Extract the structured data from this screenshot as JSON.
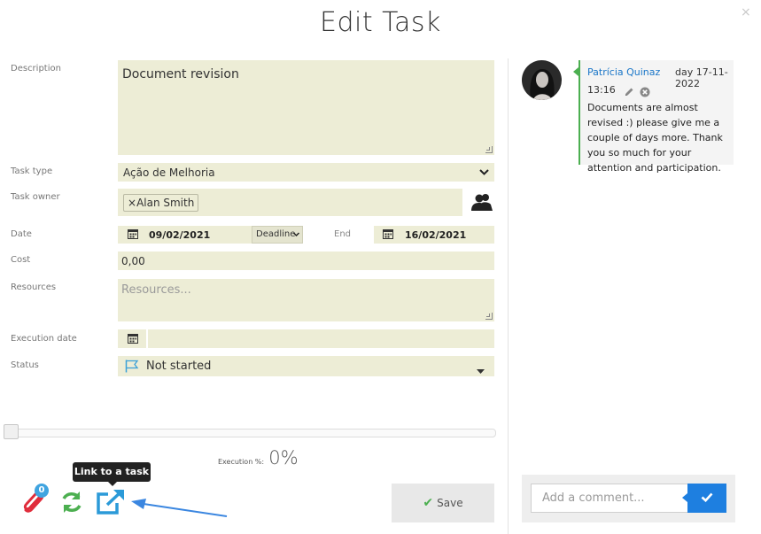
{
  "dialog": {
    "title": "Edit Task",
    "close_glyph": "×"
  },
  "form": {
    "description": {
      "label": "Description",
      "value": "Document revision"
    },
    "task_type": {
      "label": "Task type",
      "value": "Ação de Melhoria"
    },
    "task_owner": {
      "label": "Task owner",
      "chip_remove": "×",
      "chip": "Alan Smith"
    },
    "date": {
      "label": "Date",
      "start": "09/02/2021",
      "mode": "Deadline",
      "end_label": "End",
      "end": "16/02/2021"
    },
    "cost": {
      "label": "Cost",
      "value": "0,00"
    },
    "resources": {
      "label": "Resources",
      "placeholder": "Resources..."
    },
    "execution_date": {
      "label": "Execution date",
      "value": ""
    },
    "status": {
      "label": "Status",
      "value": "Not started"
    }
  },
  "execution": {
    "label": "Execution %:",
    "value": "0%",
    "progress": 0
  },
  "toolbar": {
    "attachments_count": "0",
    "tooltip": "Link to a task",
    "save_label": "Save"
  },
  "comments": [
    {
      "author": "Patrícia Quinaz",
      "date": "day 17-11-2022",
      "time": "13:16",
      "text": "Documents are almost revised :) please give me a couple of days more. Thank you so much for your attention and participation."
    }
  ],
  "comment_input": {
    "placeholder": "Add a comment..."
  },
  "colors": {
    "field_bg": "#ededd6",
    "accent_blue": "#1e7fe0",
    "comment_border": "#4caf50",
    "link_color": "#1a76c8"
  },
  "icons": [
    "close-icon",
    "calendar-icon",
    "owner-picker-icon",
    "flag-icon",
    "paperclip-icon",
    "refresh-icon",
    "external-link-icon",
    "check-icon",
    "pencil-icon",
    "delete-icon"
  ]
}
